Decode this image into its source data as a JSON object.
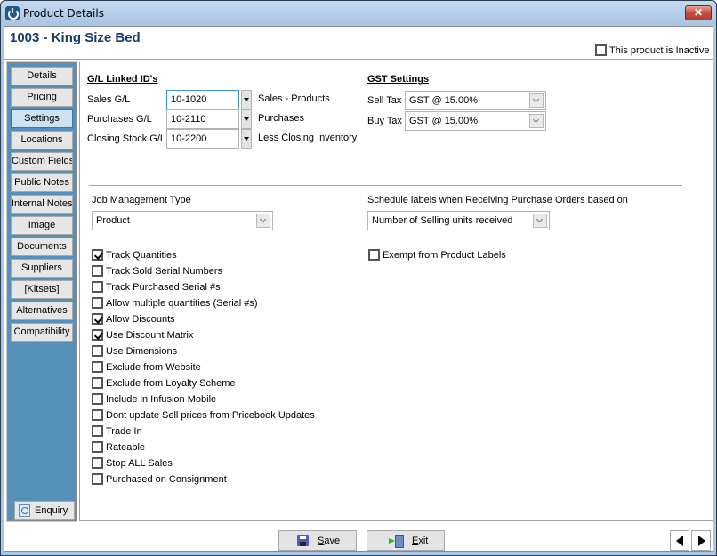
{
  "window": {
    "title": "Product Details",
    "close_glyph": "✕"
  },
  "header": {
    "product_title": "1003 - King Size Bed",
    "inactive_label": "This product is Inactive",
    "inactive_checked": false
  },
  "sidebar": {
    "items": [
      {
        "label": "Details",
        "active": false
      },
      {
        "label": "Pricing",
        "active": false
      },
      {
        "label": "Settings",
        "active": true
      },
      {
        "label": "Locations",
        "active": false
      },
      {
        "label": "Custom Fields",
        "active": false
      },
      {
        "label": "Public Notes",
        "active": false
      },
      {
        "label": "Internal Notes",
        "active": false
      },
      {
        "label": "Image",
        "active": false
      },
      {
        "label": "Documents",
        "active": false
      },
      {
        "label": "Suppliers",
        "active": false
      },
      {
        "label": "[Kitsets]",
        "active": false
      },
      {
        "label": "Alternatives",
        "active": false
      },
      {
        "label": "Compatibility",
        "active": false
      }
    ],
    "enquiry_label": "Enquiry"
  },
  "gl": {
    "title": "G/L Linked ID's",
    "rows": [
      {
        "label": "Sales G/L",
        "value": "10-1020",
        "description": "Sales - Products"
      },
      {
        "label": "Purchases G/L",
        "value": "10-2110",
        "description": "Purchases"
      },
      {
        "label": "Closing Stock G/L",
        "value": "10-2200",
        "description": "Less Closing Inventory"
      }
    ]
  },
  "gst": {
    "title": "GST Settings",
    "sell_tax_label": "Sell Tax",
    "sell_tax_value": "GST @ 15.00%",
    "buy_tax_label": "Buy Tax",
    "buy_tax_value": "GST @ 15.00%"
  },
  "job_management": {
    "label": "Job Management Type",
    "value": "Product"
  },
  "schedule_labels": {
    "label": "Schedule labels when Receiving Purchase Orders based on",
    "value": "Number of Selling units received"
  },
  "exempt_labels": {
    "label": "Exempt from Product Labels",
    "checked": false
  },
  "options": [
    {
      "label": "Track Quantities",
      "checked": true
    },
    {
      "label": "Track Sold Serial Numbers",
      "checked": false
    },
    {
      "label": "Track Purchased Serial #s",
      "checked": false
    },
    {
      "label": "Allow multiple quantities (Serial #s)",
      "checked": false
    },
    {
      "label": "Allow Discounts",
      "checked": true
    },
    {
      "label": "Use Discount Matrix",
      "checked": true
    },
    {
      "label": "Use Dimensions",
      "checked": false
    },
    {
      "label": "Exclude from Website",
      "checked": false
    },
    {
      "label": "Exclude from Loyalty Scheme",
      "checked": false
    },
    {
      "label": "Include in Infusion Mobile",
      "checked": false
    },
    {
      "label": "Dont update Sell prices from Pricebook Updates",
      "checked": false
    },
    {
      "label": "Trade In",
      "checked": false
    },
    {
      "label": "Rateable",
      "checked": false
    },
    {
      "label": "Stop ALL Sales",
      "checked": false
    },
    {
      "label": "Purchased on Consignment",
      "checked": false
    }
  ],
  "footer": {
    "save_mnemonic": "S",
    "save_rest": "ave",
    "exit_mnemonic": "E",
    "exit_rest": "xit"
  }
}
